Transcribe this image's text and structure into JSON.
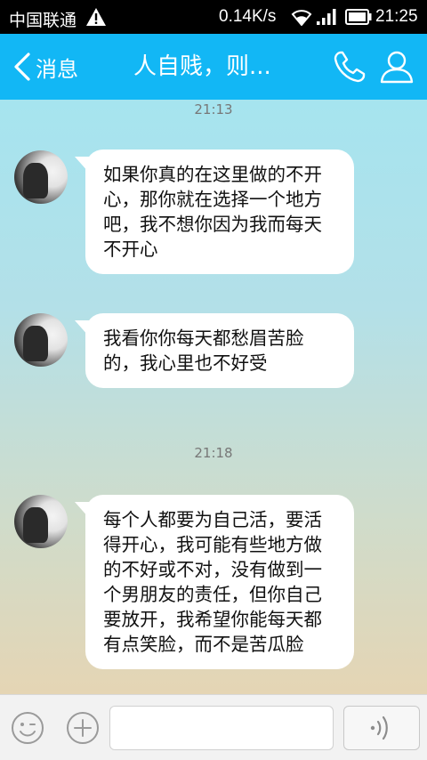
{
  "status_bar": {
    "carrier": "中国联通",
    "net_speed": "0.14K/s",
    "time": "21:25"
  },
  "header": {
    "back_label": "消息",
    "title": "人自贱，则..."
  },
  "messages": [
    {
      "time": "21:13",
      "text": "如果你真的在这里做的不开心，那你就在选择一个地方吧，我不想你因为我而每天不开心"
    },
    {
      "text": "我看你你每天都愁眉苦脸的，我心里也不好受"
    },
    {
      "time": "21:18",
      "text": "每个人都要为自己活，要活得开心，我可能有些地方做的不好或不对，没有做到一个男朋友的责任，但你自己要放开，我希望你能每天都有点笑脸，而不是苦瓜脸"
    }
  ],
  "icons": {
    "back": "chevron-left-icon",
    "call": "phone-icon",
    "profile": "person-icon",
    "emoji": "smiley-icon",
    "more": "plus-circle-icon",
    "voice": "voice-wave-icon"
  },
  "colors": {
    "header": "#12b7f5",
    "bubble": "#ffffff",
    "input_bar": "#f2f2f2"
  }
}
